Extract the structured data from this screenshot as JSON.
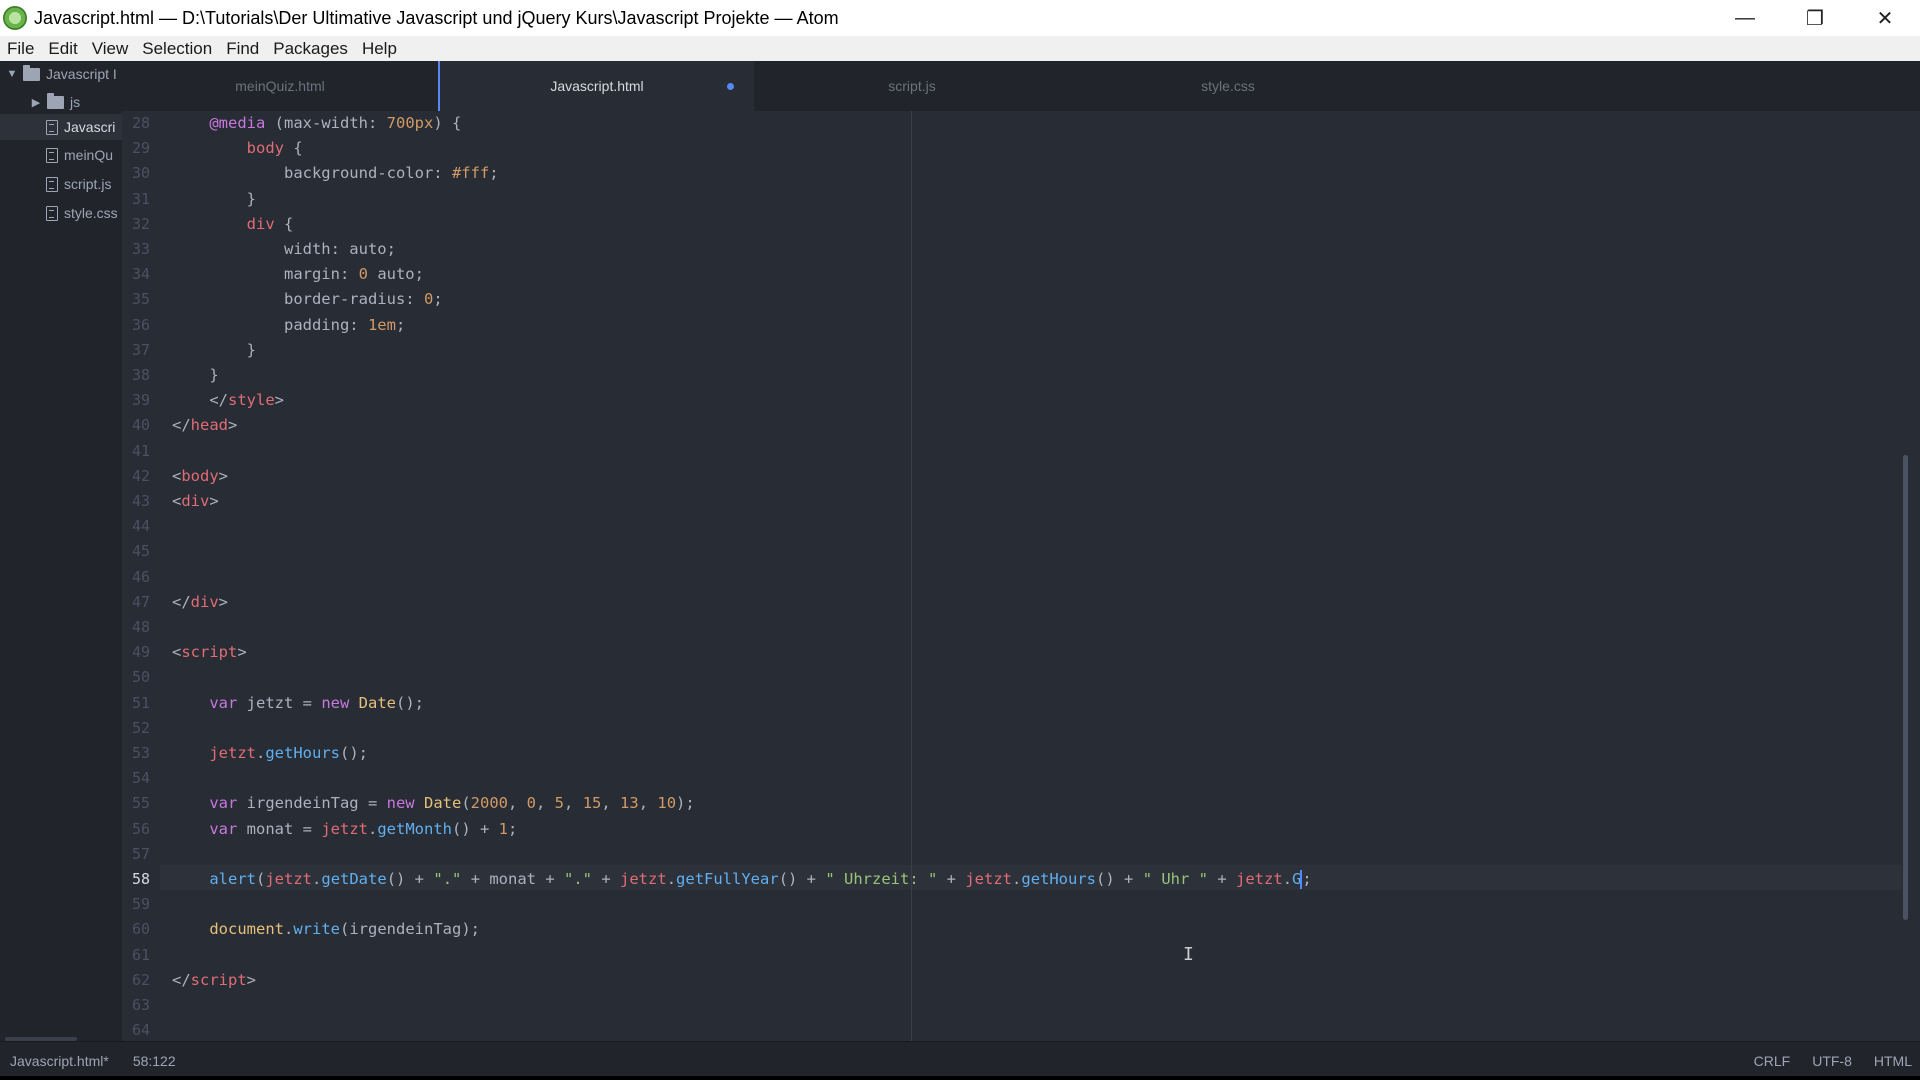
{
  "window": {
    "title": "Javascript.html — D:\\Tutorials\\Der Ultimative Javascript und jQuery Kurs\\Javascript Projekte — Atom",
    "controls": {
      "minimize": "—",
      "restore": "❐",
      "close": "✕"
    }
  },
  "menu": [
    "File",
    "Edit",
    "View",
    "Selection",
    "Find",
    "Packages",
    "Help"
  ],
  "tree": {
    "root": "Javascript I",
    "items": [
      {
        "label": "js",
        "type": "folder"
      },
      {
        "label": "Javascri",
        "type": "file",
        "selected": true
      },
      {
        "label": "meinQu",
        "type": "file"
      },
      {
        "label": "script.js",
        "type": "file"
      },
      {
        "label": "style.css",
        "type": "file"
      }
    ]
  },
  "tabs": [
    {
      "label": "meinQuiz.html",
      "active": false
    },
    {
      "label": "Javascript.html",
      "active": true,
      "modified": true
    },
    {
      "label": "script.js",
      "active": false
    },
    {
      "label": "style.css",
      "active": false
    }
  ],
  "editor": {
    "current_line": 58,
    "lines": [
      {
        "n": 28,
        "tokens": [
          [
            "p",
            "    "
          ],
          [
            "at",
            "@media"
          ],
          [
            "p",
            " (max-width: "
          ],
          [
            "n",
            "700px"
          ],
          [
            "p",
            ") {"
          ]
        ]
      },
      {
        "n": 29,
        "tokens": [
          [
            "p",
            "        "
          ],
          [
            "t",
            "body"
          ],
          [
            "p",
            " {"
          ]
        ]
      },
      {
        "n": 30,
        "tokens": [
          [
            "p",
            "            background-color: "
          ],
          [
            "n",
            "#fff"
          ],
          [
            "p",
            ";"
          ]
        ]
      },
      {
        "n": 31,
        "tokens": [
          [
            "p",
            "        }"
          ]
        ]
      },
      {
        "n": 32,
        "tokens": [
          [
            "p",
            "        "
          ],
          [
            "t",
            "div"
          ],
          [
            "p",
            " {"
          ]
        ]
      },
      {
        "n": 33,
        "tokens": [
          [
            "p",
            "            width: auto;"
          ]
        ]
      },
      {
        "n": 34,
        "tokens": [
          [
            "p",
            "            margin: "
          ],
          [
            "n",
            "0"
          ],
          [
            "p",
            " auto;"
          ]
        ]
      },
      {
        "n": 35,
        "tokens": [
          [
            "p",
            "            border-radius: "
          ],
          [
            "n",
            "0"
          ],
          [
            "p",
            ";"
          ]
        ]
      },
      {
        "n": 36,
        "tokens": [
          [
            "p",
            "            padding: "
          ],
          [
            "n",
            "1em"
          ],
          [
            "p",
            ";"
          ]
        ]
      },
      {
        "n": 37,
        "tokens": [
          [
            "p",
            "        }"
          ]
        ]
      },
      {
        "n": 38,
        "tokens": [
          [
            "p",
            "    }"
          ]
        ]
      },
      {
        "n": 39,
        "tokens": [
          [
            "p",
            "    </"
          ],
          [
            "t",
            "style"
          ],
          [
            "p",
            ">"
          ]
        ]
      },
      {
        "n": 40,
        "tokens": [
          [
            "p",
            "</"
          ],
          [
            "t",
            "head"
          ],
          [
            "p",
            ">"
          ]
        ]
      },
      {
        "n": 41,
        "tokens": []
      },
      {
        "n": 42,
        "tokens": [
          [
            "p",
            "<"
          ],
          [
            "t",
            "body"
          ],
          [
            "p",
            ">"
          ]
        ]
      },
      {
        "n": 43,
        "tokens": [
          [
            "p",
            "<"
          ],
          [
            "t",
            "div"
          ],
          [
            "p",
            ">"
          ]
        ]
      },
      {
        "n": 44,
        "tokens": []
      },
      {
        "n": 45,
        "tokens": []
      },
      {
        "n": 46,
        "tokens": []
      },
      {
        "n": 47,
        "tokens": [
          [
            "p",
            "</"
          ],
          [
            "t",
            "div"
          ],
          [
            "p",
            ">"
          ]
        ]
      },
      {
        "n": 48,
        "tokens": []
      },
      {
        "n": 49,
        "tokens": [
          [
            "p",
            "<"
          ],
          [
            "t",
            "script"
          ],
          [
            "p",
            ">"
          ]
        ]
      },
      {
        "n": 50,
        "tokens": []
      },
      {
        "n": 51,
        "tokens": [
          [
            "p",
            "    "
          ],
          [
            "k",
            "var"
          ],
          [
            "p",
            " jetzt = "
          ],
          [
            "k",
            "new"
          ],
          [
            "p",
            " "
          ],
          [
            "c",
            "Date"
          ],
          [
            "p",
            "();"
          ]
        ]
      },
      {
        "n": 52,
        "tokens": []
      },
      {
        "n": 53,
        "tokens": [
          [
            "p",
            "    "
          ],
          [
            "v",
            "jetzt"
          ],
          [
            "p",
            "."
          ],
          [
            "f",
            "getHours"
          ],
          [
            "p",
            "();"
          ]
        ]
      },
      {
        "n": 54,
        "tokens": []
      },
      {
        "n": 55,
        "tokens": [
          [
            "p",
            "    "
          ],
          [
            "k",
            "var"
          ],
          [
            "p",
            " irgendeinTag = "
          ],
          [
            "k",
            "new"
          ],
          [
            "p",
            " "
          ],
          [
            "c",
            "Date"
          ],
          [
            "p",
            "("
          ],
          [
            "n",
            "2000"
          ],
          [
            "p",
            ", "
          ],
          [
            "n",
            "0"
          ],
          [
            "p",
            ", "
          ],
          [
            "n",
            "5"
          ],
          [
            "p",
            ", "
          ],
          [
            "n",
            "15"
          ],
          [
            "p",
            ", "
          ],
          [
            "n",
            "13"
          ],
          [
            "p",
            ", "
          ],
          [
            "n",
            "10"
          ],
          [
            "p",
            ");"
          ]
        ]
      },
      {
        "n": 56,
        "tokens": [
          [
            "p",
            "    "
          ],
          [
            "k",
            "var"
          ],
          [
            "p",
            " monat = "
          ],
          [
            "v",
            "jetzt"
          ],
          [
            "p",
            "."
          ],
          [
            "f",
            "getMonth"
          ],
          [
            "p",
            "() + "
          ],
          [
            "n",
            "1"
          ],
          [
            "p",
            ";"
          ]
        ]
      },
      {
        "n": 57,
        "tokens": []
      },
      {
        "n": 58,
        "tokens": [
          [
            "p",
            "    "
          ],
          [
            "f",
            "alert"
          ],
          [
            "p",
            "("
          ],
          [
            "v",
            "jetzt"
          ],
          [
            "p",
            "."
          ],
          [
            "f",
            "getDate"
          ],
          [
            "p",
            "() + "
          ],
          [
            "s",
            "\".\""
          ],
          [
            "p",
            " + monat + "
          ],
          [
            "s",
            "\".\""
          ],
          [
            "p",
            " + "
          ],
          [
            "v",
            "jetzt"
          ],
          [
            "p",
            "."
          ],
          [
            "f",
            "getFullYear"
          ],
          [
            "p",
            "() + "
          ],
          [
            "s",
            "\" Uhrzeit: \""
          ],
          [
            "p",
            " + "
          ],
          [
            "v",
            "jetzt"
          ],
          [
            "p",
            "."
          ],
          [
            "f",
            "getHours"
          ],
          [
            "p",
            "() + "
          ],
          [
            "s",
            "\" Uhr \""
          ],
          [
            "p",
            " + "
          ],
          [
            "v",
            "jetzt"
          ],
          [
            "p",
            "."
          ],
          [
            "f",
            "G"
          ]
        ],
        "caret": true
      },
      {
        "n": 59,
        "tokens": []
      },
      {
        "n": 60,
        "tokens": [
          [
            "p",
            "    "
          ],
          [
            "c",
            "document"
          ],
          [
            "p",
            "."
          ],
          [
            "f",
            "write"
          ],
          [
            "p",
            "(irgendeinTag);"
          ]
        ]
      },
      {
        "n": 61,
        "tokens": []
      },
      {
        "n": 62,
        "tokens": [
          [
            "p",
            "</"
          ],
          [
            "t",
            "script"
          ],
          [
            "p",
            ">"
          ]
        ]
      },
      {
        "n": 63,
        "tokens": []
      },
      {
        "n": 64,
        "tokens": []
      }
    ]
  },
  "status": {
    "file": "Javascript.html*",
    "cursor": "58:122",
    "line_ending": "CRLF",
    "encoding": "UTF-8",
    "grammar": "HTML"
  },
  "colors": {
    "background": "#282c34",
    "panel": "#21252b",
    "accent": "#568af2"
  }
}
